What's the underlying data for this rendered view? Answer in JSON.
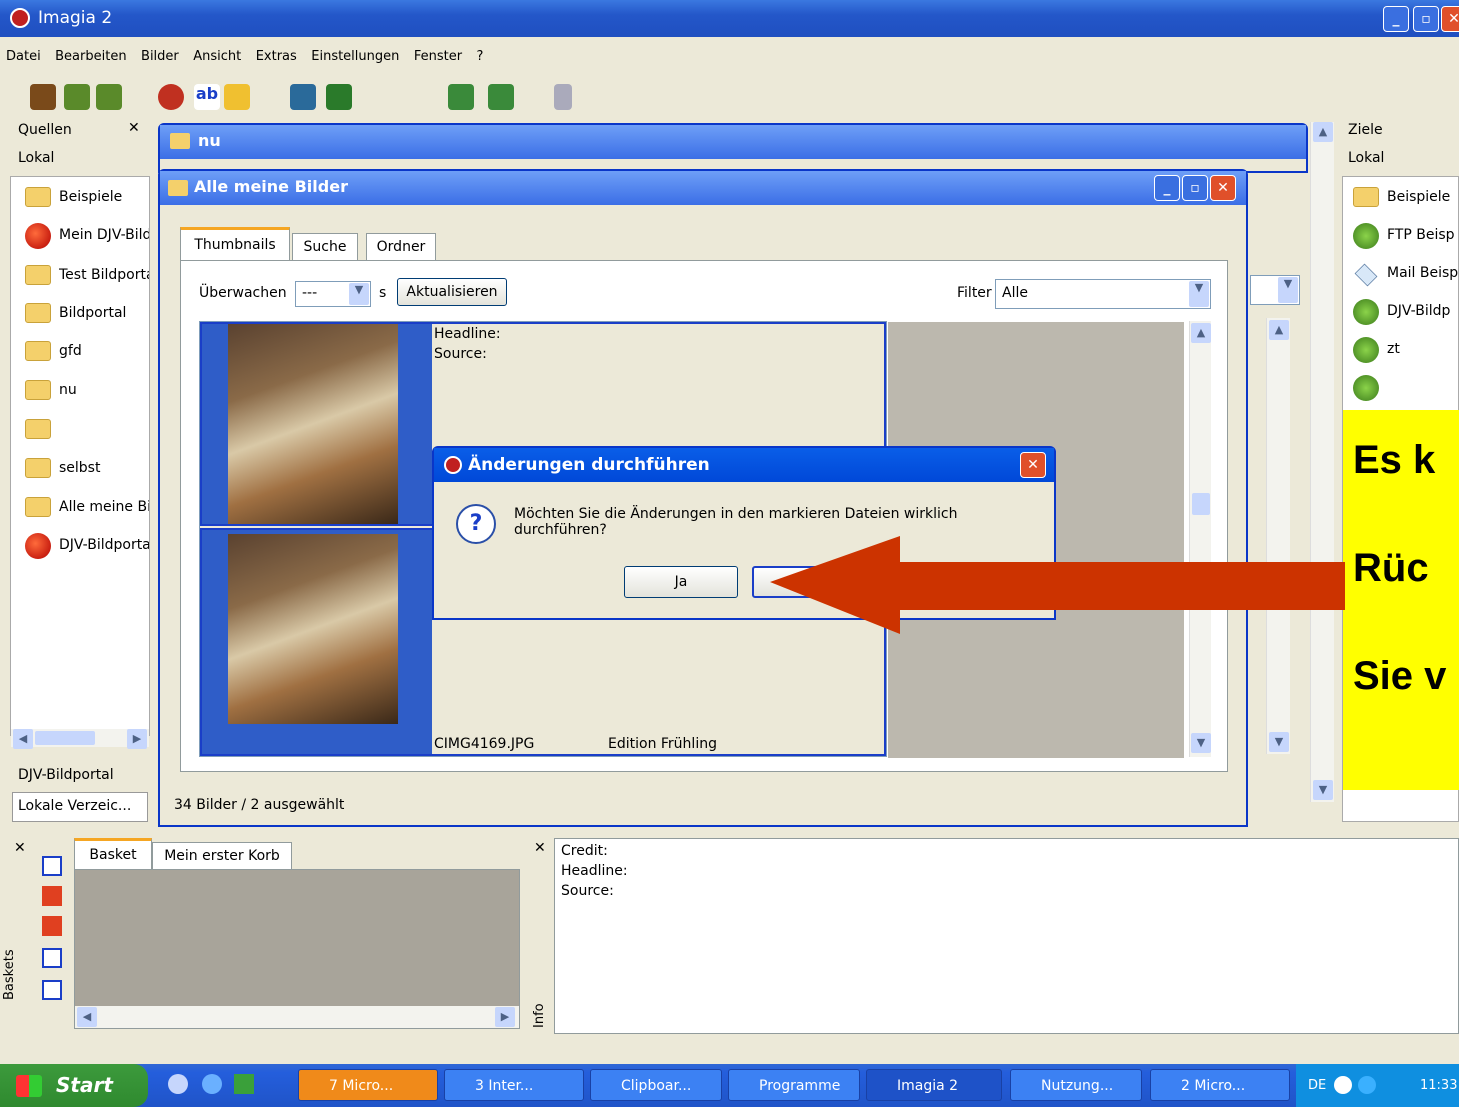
{
  "window": {
    "title": "Imagia 2"
  },
  "menu": [
    "Datei",
    "Bearbeiten",
    "Bilder",
    "Ansicht",
    "Extras",
    "Einstellungen",
    "Fenster",
    "?"
  ],
  "left_panel": {
    "header": "Quellen",
    "sub": "Lokal",
    "items": [
      "Beispiele",
      "Mein DJV-Bild",
      "Test Bildporta",
      "Bildportal",
      "gfd",
      "nu",
      "",
      "selbst",
      "Alle meine Bil",
      "DJV-Bildporta"
    ],
    "footer1": "DJV-Bildportal",
    "footer2": "Lokale Verzeic..."
  },
  "right_panel": {
    "header": "Ziele",
    "sub": "Lokal",
    "items": [
      "Beispiele",
      "FTP Beisp",
      "Mail Beisp",
      "DJV-Bildp",
      "zt",
      ""
    ]
  },
  "window_nu": {
    "title": "nu"
  },
  "window_main": {
    "title": "Alle meine Bilder",
    "tabs": [
      "Thumbnails",
      "Suche",
      "Ordner"
    ],
    "watch_label": "Überwachen",
    "watch_value": "---",
    "watch_unit": "s",
    "refresh": "Aktualisieren",
    "filter_label": "Filter",
    "filter_value": "Alle",
    "meta_headline": "Headline:",
    "meta_source": "Source:",
    "filename": "CIMG4169.JPG",
    "edition": "Edition Frühling",
    "status": "34 Bilder / 2 ausgewählt"
  },
  "dialog": {
    "title": "Änderungen durchführen",
    "message": "Möchten Sie die Änderungen in den markieren Dateien wirklich durchführen?",
    "yes": "Ja"
  },
  "annotation": {
    "lines": [
      "Es k",
      "Rüc",
      "Sie v"
    ],
    "arrow_color": "#cc3300"
  },
  "basket": {
    "side_label": "Baskets",
    "tabs": [
      "Basket",
      "Mein erster Korb"
    ]
  },
  "info": {
    "side_label": "Info",
    "fields": [
      "Credit:",
      "Headline:",
      "Source:"
    ]
  },
  "taskbar": {
    "start": "Start",
    "tasks": [
      "7 Micro...",
      "3 Inter...",
      "Clipboar...",
      "Programme",
      "Imagia 2",
      "Nutzung...",
      "2 Micro..."
    ],
    "lang": "DE",
    "time": "11:33"
  }
}
